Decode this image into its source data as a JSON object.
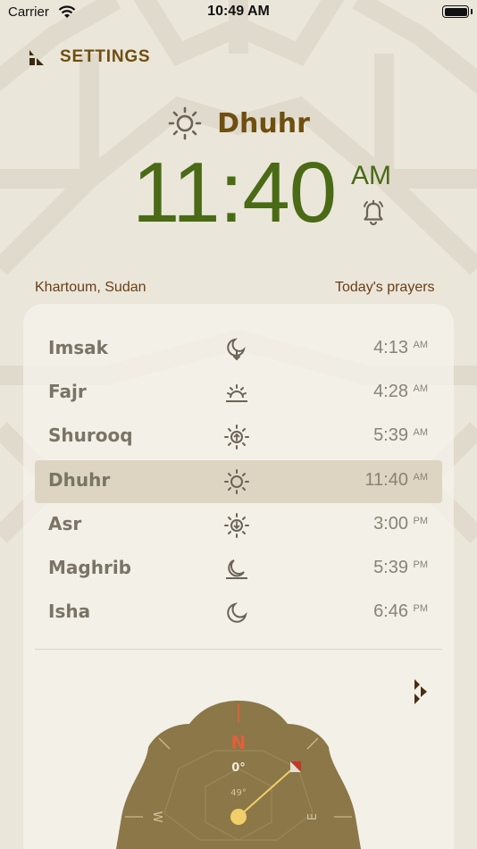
{
  "status_bar": {
    "carrier": "Carrier",
    "time": "10:49 AM"
  },
  "header": {
    "settings_label": "SETTINGS"
  },
  "current_prayer": {
    "name": "Dhuhr",
    "time": "11:40",
    "period": "AM"
  },
  "location": "Khartoum, Sudan",
  "today_label": "Today's prayers",
  "prayers": [
    {
      "name": "Imsak",
      "icon": "moon-down-icon",
      "time": "4:13",
      "period": "AM"
    },
    {
      "name": "Fajr",
      "icon": "sunrise-icon",
      "time": "4:28",
      "period": "AM"
    },
    {
      "name": "Shurooq",
      "icon": "sun-up-icon",
      "time": "5:39",
      "period": "AM"
    },
    {
      "name": "Dhuhr",
      "icon": "sun-icon",
      "time": "11:40",
      "period": "AM",
      "active": true
    },
    {
      "name": "Asr",
      "icon": "sun-down-icon",
      "time": "3:00",
      "period": "PM"
    },
    {
      "name": "Maghrib",
      "icon": "sunset-moon-icon",
      "time": "5:39",
      "period": "PM"
    },
    {
      "name": "Isha",
      "icon": "moon-icon",
      "time": "6:46",
      "period": "PM"
    }
  ],
  "compass": {
    "north": "N",
    "east": "E",
    "west": "W",
    "heading": "0°",
    "qibla": "49°"
  },
  "colors": {
    "background": "#ebe6da",
    "accent_brown": "#6e4f10",
    "time_green": "#4a6a16",
    "active_row": "#ddd5c1",
    "compass_fill": "#8b7747",
    "compass_red": "#e0603a"
  }
}
